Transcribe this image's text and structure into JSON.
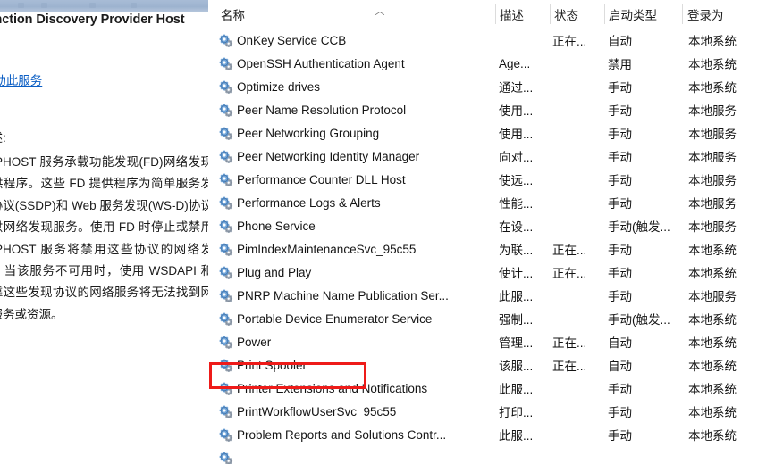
{
  "window": {
    "app": "services-management-console"
  },
  "details_pane": {
    "service_title": "Function Discovery Provider Host",
    "start_link_prefix": "启",
    "start_link_text": "动此服务",
    "description_label": "描述:",
    "description_body": "FDPHOST 服务承载功能发现(FD)网络发现提供程序。这些 FD 提供程序为简单服务发现协议(SSDP)和 Web 服务发现(WS-D)协议提供网络发现服务。使用 FD 时停止或禁用 FDPHOST 服务将禁用这些协议的网络发现。当该服务不可用时，使用 WSDAPI 和依靠这些发现协议的网络服务将无法找到网络服务或资源。"
  },
  "list": {
    "columns": [
      {
        "key": "name",
        "label": "名称"
      },
      {
        "key": "desc",
        "label": "描述"
      },
      {
        "key": "status",
        "label": "状态"
      },
      {
        "key": "startup",
        "label": "启动类型"
      },
      {
        "key": "logon",
        "label": "登录为"
      }
    ],
    "sort": {
      "column": "名称",
      "direction": "ascending",
      "glyph": "︿"
    },
    "rows": [
      {
        "name": "OnKey Service CCB",
        "desc": "",
        "status": "正在...",
        "startup": "自动",
        "logon": "本地系统"
      },
      {
        "name": "OpenSSH Authentication Agent",
        "desc": "Age...",
        "status": "",
        "startup": "禁用",
        "logon": "本地系统"
      },
      {
        "name": "Optimize drives",
        "desc": "通过...",
        "status": "",
        "startup": "手动",
        "logon": "本地系统"
      },
      {
        "name": "Peer Name Resolution Protocol",
        "desc": "使用...",
        "status": "",
        "startup": "手动",
        "logon": "本地服务"
      },
      {
        "name": "Peer Networking Grouping",
        "desc": "使用...",
        "status": "",
        "startup": "手动",
        "logon": "本地服务"
      },
      {
        "name": "Peer Networking Identity Manager",
        "desc": "向对...",
        "status": "",
        "startup": "手动",
        "logon": "本地服务"
      },
      {
        "name": "Performance Counter DLL Host",
        "desc": "使远...",
        "status": "",
        "startup": "手动",
        "logon": "本地服务"
      },
      {
        "name": "Performance Logs & Alerts",
        "desc": "性能...",
        "status": "",
        "startup": "手动",
        "logon": "本地服务"
      },
      {
        "name": "Phone Service",
        "desc": "在设...",
        "status": "",
        "startup": "手动(触发...",
        "logon": "本地服务"
      },
      {
        "name": "PimIndexMaintenanceSvc_95c55",
        "desc": "为联...",
        "status": "正在...",
        "startup": "手动",
        "logon": "本地系统"
      },
      {
        "name": "Plug and Play",
        "desc": "使计...",
        "status": "正在...",
        "startup": "手动",
        "logon": "本地系统"
      },
      {
        "name": "PNRP Machine Name Publication Ser...",
        "desc": "此服...",
        "status": "",
        "startup": "手动",
        "logon": "本地服务"
      },
      {
        "name": "Portable Device Enumerator Service",
        "desc": "强制...",
        "status": "",
        "startup": "手动(触发...",
        "logon": "本地系统"
      },
      {
        "name": "Power",
        "desc": "管理...",
        "status": "正在...",
        "startup": "自动",
        "logon": "本地系统"
      },
      {
        "name": "Print Spooler",
        "desc": "该服...",
        "status": "正在...",
        "startup": "自动",
        "logon": "本地系统"
      },
      {
        "name": "Printer Extensions and Notifications",
        "desc": "此服...",
        "status": "",
        "startup": "手动",
        "logon": "本地系统"
      },
      {
        "name": "PrintWorkflowUserSvc_95c55",
        "desc": "打印...",
        "status": "",
        "startup": "手动",
        "logon": "本地系统"
      },
      {
        "name": "Problem Reports and Solutions Contr...",
        "desc": "此服...",
        "status": "",
        "startup": "手动",
        "logon": "本地系统"
      },
      {
        "name": "",
        "desc": "",
        "status": "",
        "startup": "",
        "logon": ""
      }
    ]
  },
  "annotation": {
    "target_row": "Print Spooler",
    "color": "#ee1b19"
  },
  "icons": {
    "service_icon": "gear-icon",
    "sort_icon": "caret-up-icon"
  }
}
